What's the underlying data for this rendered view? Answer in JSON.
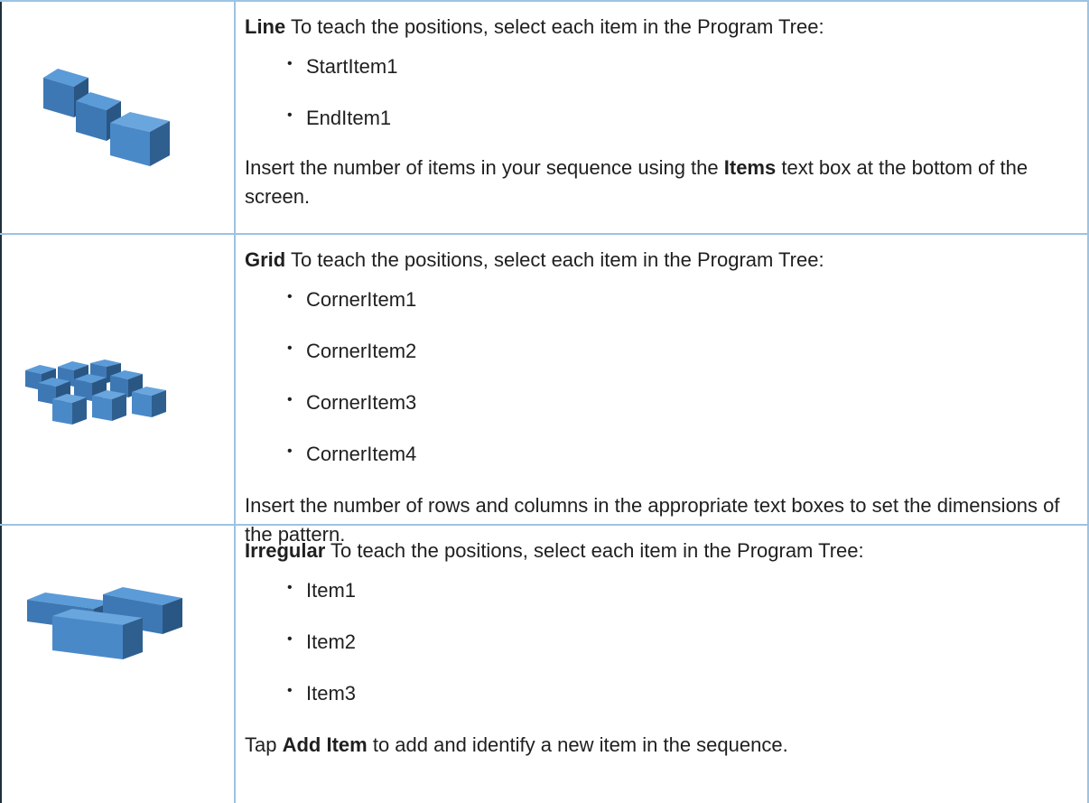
{
  "rows": [
    {
      "title": "Line",
      "intro": "To teach the positions, select each item in the Program Tree:",
      "items": [
        "StartItem1",
        "EndItem1"
      ],
      "note_before": "Insert the number of items in your sequence using the ",
      "note_bold": "Items",
      "note_after": " text box at the bottom of the screen.",
      "icon": "cube-line-icon"
    },
    {
      "title": "Grid",
      "intro": "To teach the positions, select each item in the Program Tree:",
      "items": [
        "CornerItem1",
        "CornerItem2",
        "CornerItem3",
        "CornerItem4"
      ],
      "note_before": "Insert the number of rows and columns in the appropriate text boxes to set the dimensions of the pattern.",
      "note_bold": "",
      "note_after": "",
      "icon": "cube-grid-icon"
    },
    {
      "title": "Irregular",
      "intro": "To teach the positions, select each item in the Program Tree:",
      "items": [
        "Item1",
        "Item2",
        "Item3"
      ],
      "note_before": "Tap ",
      "note_bold": "Add Item",
      "note_after": " to add and identify a new item in the sequence.",
      "icon": "irregular-blocks-icon"
    }
  ],
  "bullet_glyph": "•",
  "colors": {
    "cube_top": "#5b9bd8",
    "cube_front": "#4a89c8",
    "cube_side": "#2f5f8f",
    "border": "#9cc3e3"
  }
}
